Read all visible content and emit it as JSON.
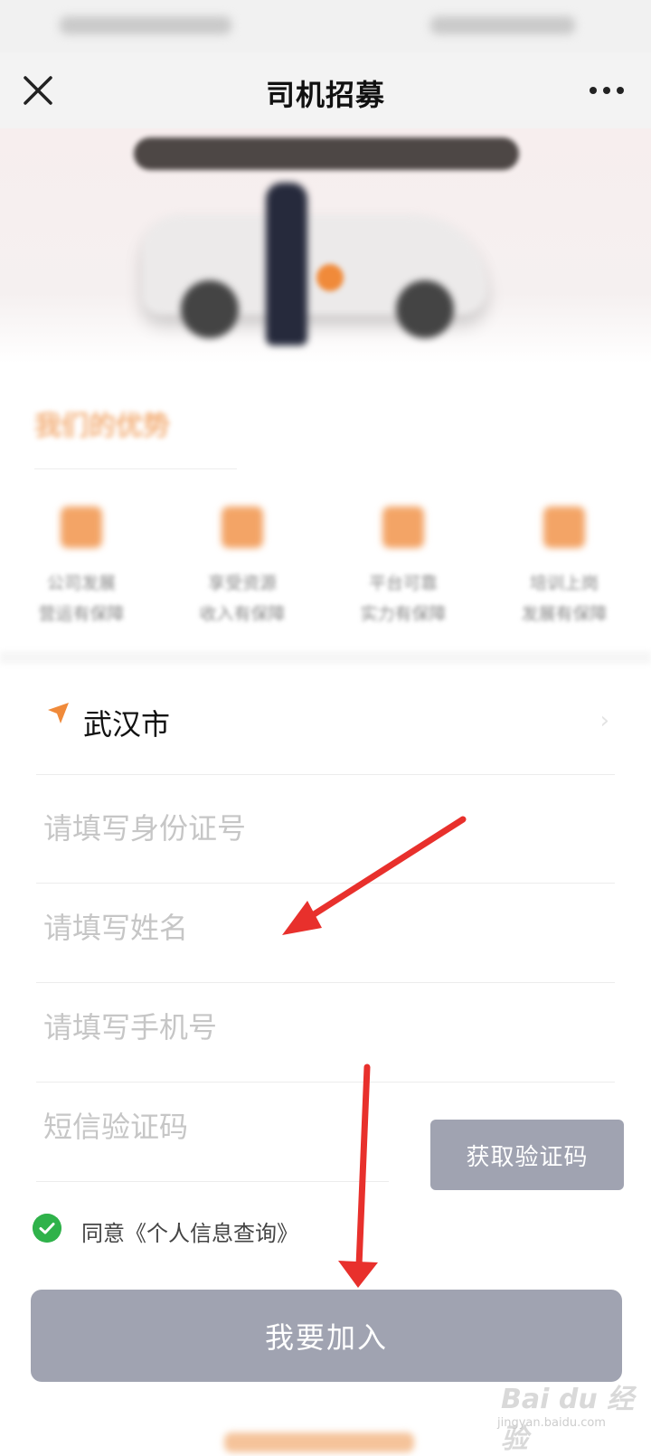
{
  "nav": {
    "title": "司机招募"
  },
  "advantages": {
    "title": "我们的优势",
    "items": [
      {
        "line1": "公司发展",
        "line2": "营运有保障"
      },
      {
        "line1": "享受资源",
        "line2": "收入有保障"
      },
      {
        "line1": "平台可靠",
        "line2": "实力有保障"
      },
      {
        "line1": "培训上岗",
        "line2": "发展有保障"
      }
    ]
  },
  "form": {
    "city": "武汉市",
    "id_placeholder": "请填写身份证号",
    "name_placeholder": "请填写姓名",
    "phone_placeholder": "请填写手机号",
    "sms_placeholder": "短信验证码",
    "sms_button": "获取验证码",
    "agree_text": "同意《个人信息查询》",
    "submit": "我要加入"
  },
  "watermark": {
    "text": "Bai du 经验",
    "sub": "jingyan.baidu.com"
  },
  "colors": {
    "accent": "#f08a3a",
    "button_gray": "#a0a3b1",
    "check_green": "#2fb24a",
    "annotation_red": "#e8302c"
  }
}
